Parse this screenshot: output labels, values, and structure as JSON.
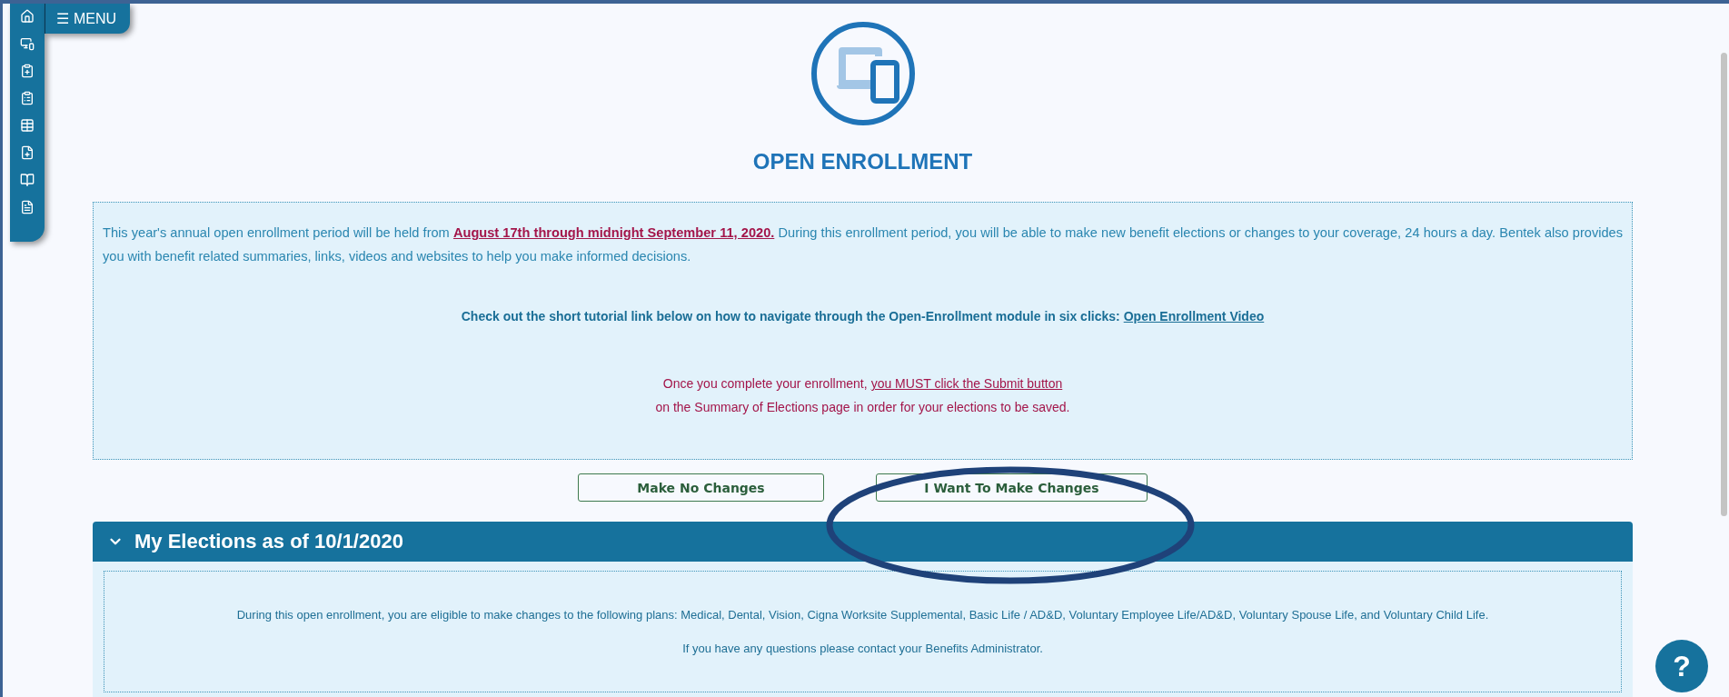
{
  "menu_button": {
    "icon": "☰",
    "label": "MENU"
  },
  "title": "OPEN ENROLLMENT",
  "notice": {
    "intro": "This year's annual open enrollment period will be held from **August 17th through midnight September 11, 2020.** During this enrollment period, you will be able to make new benefit elections or changes to your coverage, 24 hours a day. Bentek also provides you with benefit related summaries, links, videos and websites to help you make informed decisions.",
    "tutorial": {
      "text": "Check out the short tutorial link below on how to navigate through the Open-Enrollment module in six clicks:",
      "link": "Open Enrollment Video"
    },
    "warning": {
      "before": "Once you complete your enrollment,",
      "link": "you MUST click the Submit button",
      "line2": "on the Summary of Elections page in order for your elections to be saved."
    }
  },
  "buttons": [
    {
      "label": "Make No Changes"
    },
    {
      "label": "I Want To Make Changes"
    }
  ],
  "section": {
    "title": "My Elections as of 10/1/2020",
    "expanded": true,
    "paragraphs": [
      "During this open enrollment, you are eligible to make changes to the following plans: Medical, Dental, Vision, Cigna Worksite Supplemental, Basic Life / AD&D, Voluntary Employee Life/AD&D, Voluntary Spouse Life, and Voluntary Child Life.",
      "If you have any questions please contact your Benefits Administrator."
    ]
  },
  "help_button": "?"
}
